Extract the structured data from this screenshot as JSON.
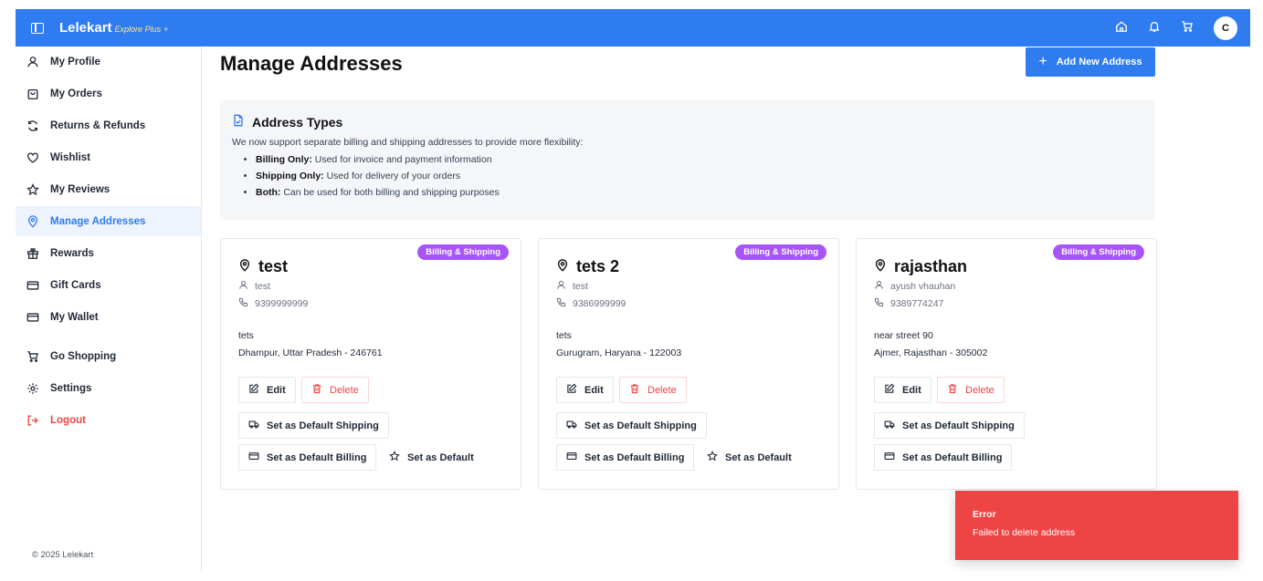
{
  "header": {
    "brand": "Lelekart",
    "tagline": "Explore Plus",
    "tagline_plus": "+",
    "avatar_initial": "C"
  },
  "sidebar": {
    "items": [
      {
        "label": "My Profile",
        "icon": "user-icon"
      },
      {
        "label": "My Orders",
        "icon": "bag-icon"
      },
      {
        "label": "Returns & Refunds",
        "icon": "refresh-icon"
      },
      {
        "label": "Wishlist",
        "icon": "heart-icon"
      },
      {
        "label": "My Reviews",
        "icon": "star-icon"
      },
      {
        "label": "Manage Addresses",
        "icon": "map-pin-icon",
        "active": true
      },
      {
        "label": "Rewards",
        "icon": "gift-icon"
      },
      {
        "label": "Gift Cards",
        "icon": "card-icon"
      },
      {
        "label": "My Wallet",
        "icon": "wallet-icon"
      },
      {
        "label": "Go Shopping",
        "icon": "cart-icon"
      },
      {
        "label": "Settings",
        "icon": "gear-icon"
      },
      {
        "label": "Logout",
        "icon": "logout-icon"
      }
    ],
    "copyright": "© 2025 Lelekart"
  },
  "page": {
    "title": "Manage Addresses",
    "add_button": "Add New Address"
  },
  "info": {
    "title": "Address Types",
    "description": "We now support separate billing and shipping addresses to provide more flexibility:",
    "items": [
      {
        "term": "Billing Only:",
        "text": " Used for invoice and payment information"
      },
      {
        "term": "Shipping Only:",
        "text": " Used for delivery of your orders"
      },
      {
        "term": "Both:",
        "text": " Can be used for both billing and shipping purposes"
      }
    ]
  },
  "cards": [
    {
      "badge": "Billing & Shipping",
      "name": "test",
      "person": "test",
      "phone": "9399999999",
      "line1": "tets",
      "line2": "Dhampur, Uttar Pradesh - 246761",
      "show_default": true
    },
    {
      "badge": "Billing & Shipping",
      "name": "tets 2",
      "person": "test",
      "phone": "9386999999",
      "line1": "tets",
      "line2": "Gurugram, Haryana - 122003",
      "show_default": true
    },
    {
      "badge": "Billing & Shipping",
      "name": "rajasthan",
      "person": "ayush vhauhan",
      "phone": "9389774247",
      "line1": "near street 90",
      "line2": "Ajmer, Rajasthan - 305002",
      "show_default": false
    }
  ],
  "card_labels": {
    "edit": "Edit",
    "delete": "Delete",
    "default_shipping": "Set as Default Shipping",
    "default_billing": "Set as Default Billing",
    "set_default": "Set as Default"
  },
  "toast": {
    "title": "Error",
    "message": "Failed to delete address"
  },
  "colors": {
    "primary": "#2f7bf0",
    "badge": "#a855f7",
    "danger": "#ef4444"
  }
}
